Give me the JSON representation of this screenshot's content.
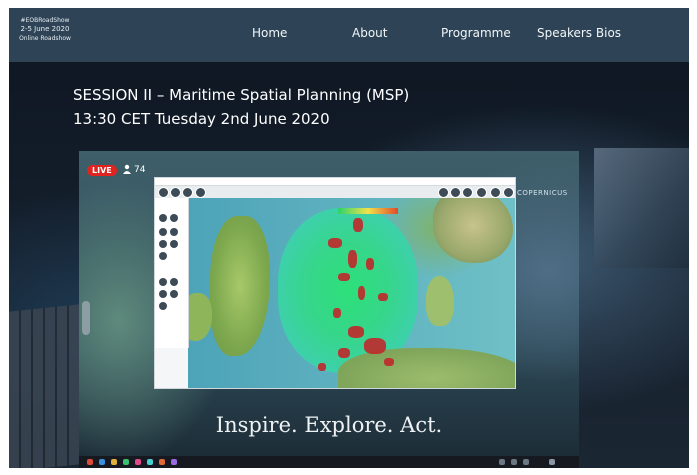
{
  "header": {
    "brand_lines": [
      "#EOBRoadShow",
      "2-5 June 2020",
      "Online Roadshow"
    ],
    "nav": [
      {
        "label": "Home"
      },
      {
        "label": "About"
      },
      {
        "label": "Programme"
      },
      {
        "label": "Speakers Bios"
      }
    ]
  },
  "session": {
    "title": "SESSION II – Maritime Spatial Planning (MSP)",
    "time": "13:30 CET Tuesday 2nd June 2020"
  },
  "video": {
    "live_label": "LIVE",
    "viewer_count": "74",
    "brand_mark": "COPERNICUS",
    "tagline": "Inspire. Explore. Act."
  },
  "colors": {
    "navbar": "#2e4456",
    "live": "#e0231f",
    "hotspot": "#c0282a",
    "sea_density": "#2de07a"
  }
}
